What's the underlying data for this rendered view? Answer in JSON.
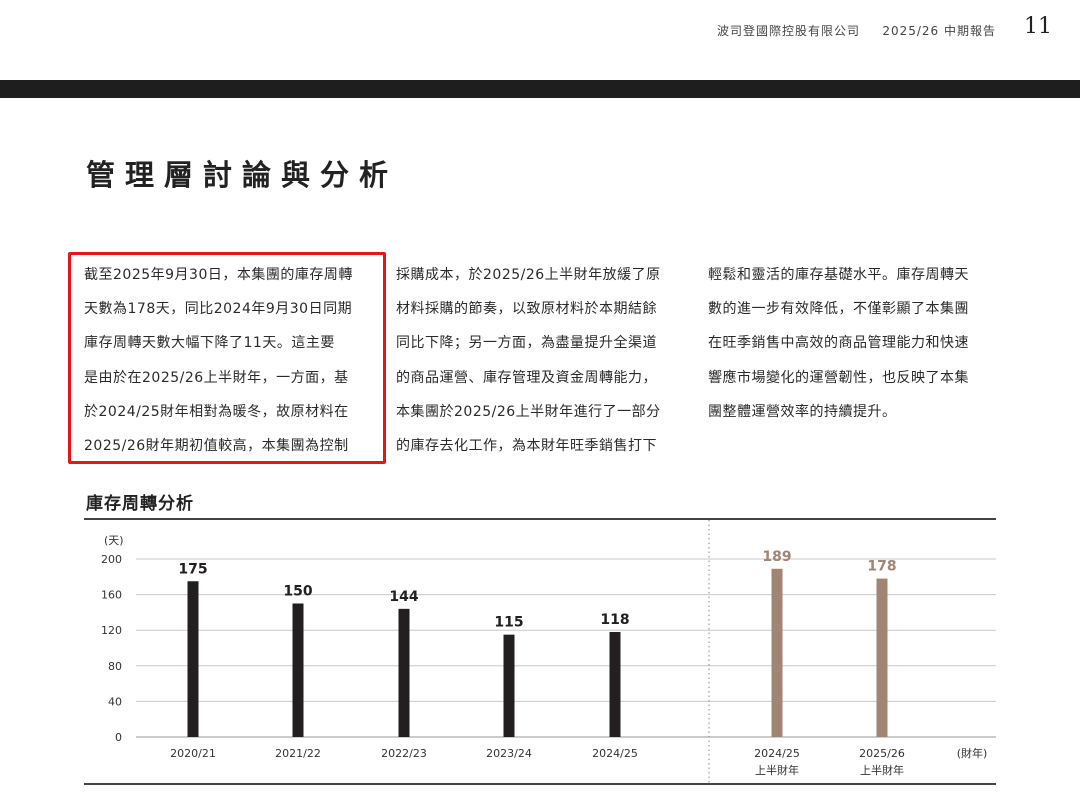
{
  "header": {
    "company": "波司登國際控股有限公司",
    "report": "2025/26 中期報告",
    "page_number": "11"
  },
  "section_title": "管理層討論與分析",
  "columns": [
    [
      "截至2025年9月30日，本集團的庫存周轉",
      "天數為178天，同比2024年9月30日同期",
      "庫存周轉天數大幅下降了11天。這主要",
      "是由於在2025/26上半財年，一方面，基",
      "於2024/25財年相對為暖冬，故原材料在",
      "2025/26財年期初值較高，本集團為控制"
    ],
    [
      "採購成本，於2025/26上半財年放緩了原",
      "材料採購的節奏，以致原材料於本期結餘",
      "同比下降；另一方面，為盡量提升全渠道",
      "的商品運營、庫存管理及資金周轉能力，",
      "本集團於2025/26上半財年進行了一部分",
      "的庫存去化工作，為本財年旺季銷售打下"
    ],
    [
      "輕鬆和靈活的庫存基礎水平。庫存周轉天",
      "數的進一步有效降低，不僅彰顯了本集團",
      "在旺季銷售中高效的商品管理能力和快速",
      "響應市場變化的運營韌性，也反映了本集",
      "團整體運營效率的持續提升。"
    ]
  ],
  "chart_data": {
    "type": "bar",
    "title": "庫存周轉分析",
    "ylabel": "(天)",
    "xlabel": "(財年)",
    "ylim": [
      0,
      200
    ],
    "yticks": [
      0,
      40,
      80,
      120,
      160,
      200
    ],
    "grid": true,
    "categories": [
      "2020/21",
      "2021/22",
      "2022/23",
      "2023/24",
      "2024/25",
      "2024/25\n上半財年",
      "2025/26\n上半財年"
    ],
    "values": [
      175,
      150,
      144,
      115,
      118,
      189,
      178
    ],
    "colors": [
      "#231f20",
      "#231f20",
      "#231f20",
      "#231f20",
      "#231f20",
      "#a08575",
      "#a08575"
    ],
    "label_colors": [
      "#231f20",
      "#231f20",
      "#231f20",
      "#231f20",
      "#231f20",
      "#a08575",
      "#a08575"
    ]
  }
}
